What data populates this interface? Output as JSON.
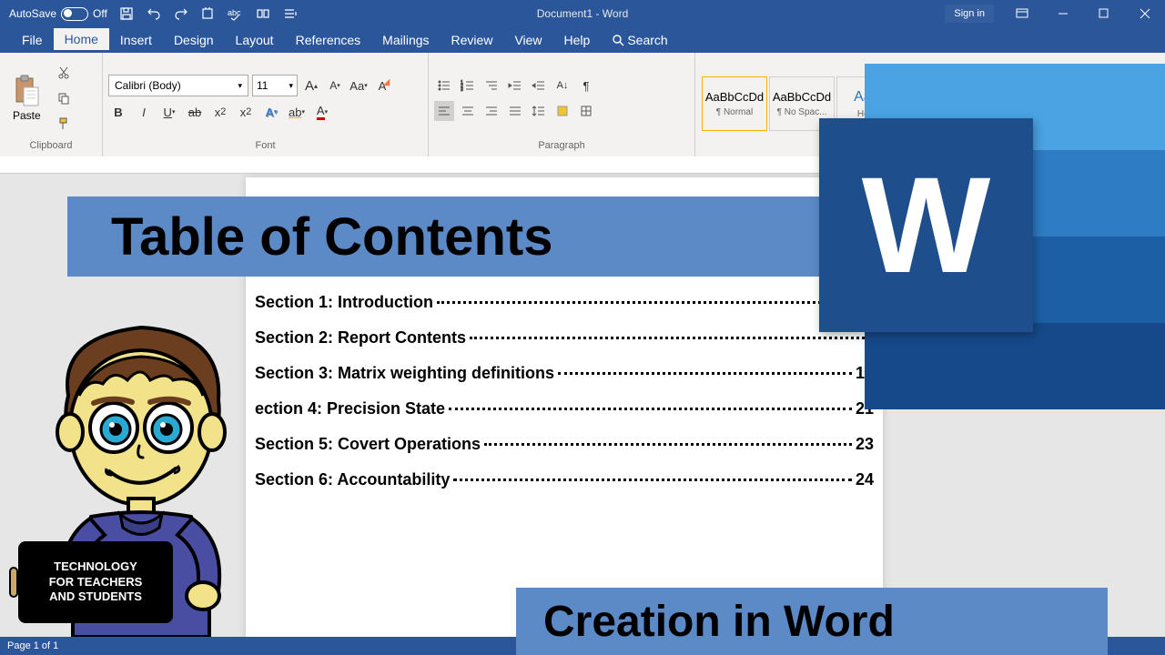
{
  "titlebar": {
    "autosave": "AutoSave",
    "off": "Off",
    "title": "Document1 - Word",
    "signin": "Sign in"
  },
  "menu": {
    "file": "File",
    "home": "Home",
    "insert": "Insert",
    "design": "Design",
    "layout": "Layout",
    "references": "References",
    "mailings": "Mailings",
    "review": "Review",
    "view": "View",
    "help": "Help",
    "search": "Search"
  },
  "ribbon": {
    "clipboard": "Clipboard",
    "paste": "Paste",
    "font": "Font",
    "paragraph": "Paragraph",
    "fontname": "Calibri (Body)",
    "fontsize": "11",
    "styles": {
      "normal_sample": "AaBbCcDd",
      "normal": "¶ Normal",
      "nospac_sample": "AaBbCcDd",
      "nospac": "¶ No Spac...",
      "heading_sample": "AaBl",
      "heading": "Headi"
    }
  },
  "toc": {
    "items": [
      {
        "title": "Section 1: Introduction",
        "page": ""
      },
      {
        "title": "Section 2: Report Contents",
        "page": ""
      },
      {
        "title": "Section 3: Matrix weighting definitions",
        "page": "12"
      },
      {
        "title": "ection 4: Precision State",
        "page": "21"
      },
      {
        "title": "Section 5: Covert Operations",
        "page": "23"
      },
      {
        "title": "Section 6: Accountability",
        "page": "24"
      }
    ]
  },
  "overlay": {
    "title": "Table of Contents",
    "bottom": "Creation in Word"
  },
  "tablet": {
    "l1": "TECHNOLOGY",
    "l2": "FOR TEACHERS",
    "l3": "AND STUDENTS"
  },
  "status": {
    "page": "Page 1 of 1"
  }
}
